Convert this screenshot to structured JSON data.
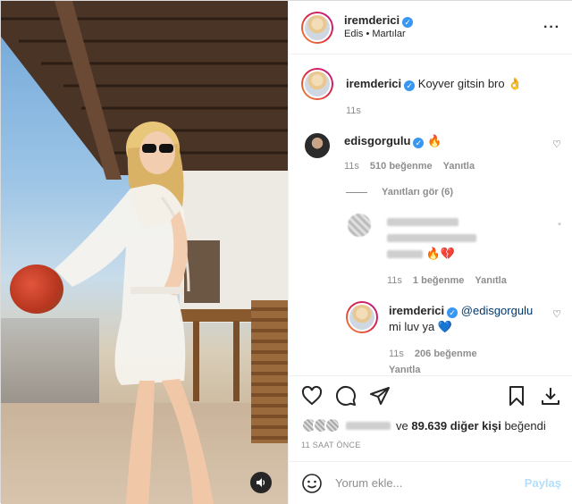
{
  "post": {
    "author": "iremderici",
    "verified": true,
    "location": "Edis • Martılar"
  },
  "comments": [
    {
      "user": "iremderici",
      "text": "Koyver gitsin bro 👌",
      "time": "11s"
    },
    {
      "user": "edisgorgulu",
      "text": "🔥",
      "time": "11s",
      "likes": "510 beğenme",
      "reply": "Yanıtla",
      "view_replies": "Yanıtları gör (6)"
    }
  ],
  "replies": [
    {
      "user": "",
      "time": "11s",
      "likes": "1 beğenme",
      "reply": "Yanıtla",
      "emoji": "🔥💔"
    },
    {
      "user": "iremderici",
      "mention": "@edisgorgulu",
      "text": "mi luv ya 💙",
      "time": "11s",
      "likes": "206 beğenme",
      "reply": "Yanıtla"
    }
  ],
  "likes_line": {
    "suffix": "ve",
    "count_text": "89.639 diğer kişi",
    "verb": "beğendi"
  },
  "timestamp": "11 SAAT ÖNCE",
  "comment_box": {
    "placeholder": "Yorum ekle...",
    "post_label": "Paylaş"
  },
  "icons": {
    "more": "more-icon",
    "like": "heart-icon",
    "comment": "comment-icon",
    "share": "share-icon",
    "save": "bookmark-icon",
    "download": "download-icon",
    "emoji": "emoji-icon",
    "sound": "sound-icon"
  },
  "colors": {
    "verified": "#3897f0",
    "link": "#00376b",
    "muted": "#8e8e8e",
    "post_disabled": "#b2dffc"
  }
}
